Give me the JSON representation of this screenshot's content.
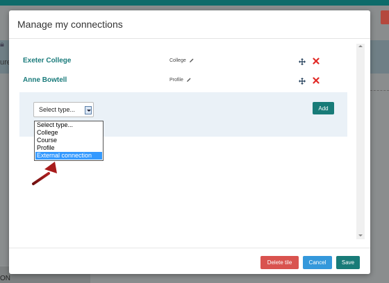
{
  "background": {
    "left_fragment": "ure",
    "bottom_fragment": "ON"
  },
  "modal": {
    "title": "Manage my connections",
    "connections": [
      {
        "name": "Exeter College",
        "type": "College"
      },
      {
        "name": "Anne Bowtell",
        "type": "Profile"
      }
    ],
    "select": {
      "value": "Select type...",
      "options": [
        "Select type...",
        "College",
        "Course",
        "Profile",
        "External connection"
      ],
      "highlighted": "External connection"
    },
    "add_label": "Add",
    "footer": {
      "delete_label": "Delete tile",
      "cancel_label": "Cancel",
      "save_label": "Save"
    }
  },
  "colors": {
    "accent": "#187b78",
    "delete": "#d9534f",
    "cancel": "#3498db",
    "annotation_arrow": "#8b1a1a"
  }
}
